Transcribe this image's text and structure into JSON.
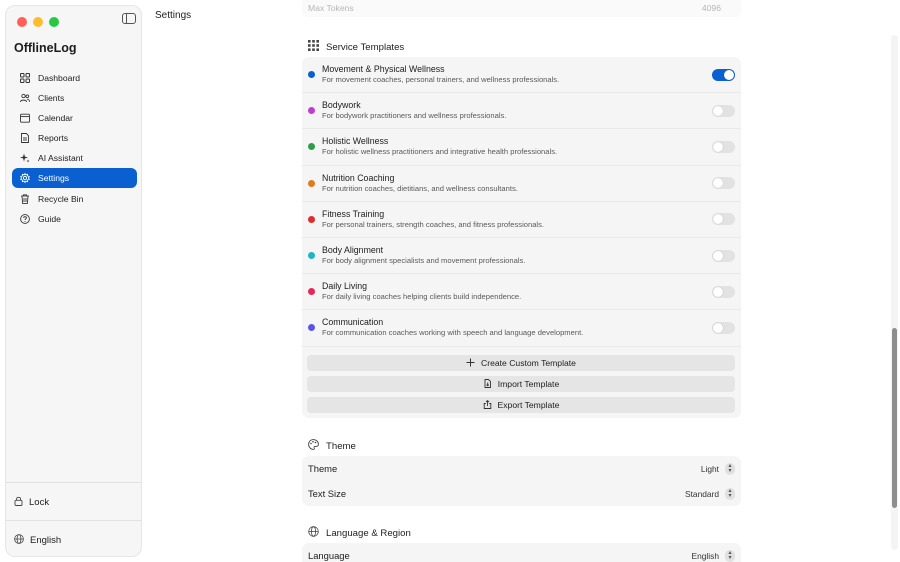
{
  "app": {
    "title": "OfflineLog"
  },
  "header": {
    "title": "Settings"
  },
  "sidebar": {
    "items": [
      {
        "label": "Dashboard",
        "icon": "grid-icon"
      },
      {
        "label": "Clients",
        "icon": "people-icon"
      },
      {
        "label": "Calendar",
        "icon": "calendar-icon"
      },
      {
        "label": "Reports",
        "icon": "document-icon"
      },
      {
        "label": "AI Assistant",
        "icon": "sparkle-icon"
      },
      {
        "label": "Settings",
        "icon": "gear-icon",
        "active": true
      },
      {
        "label": "Recycle Bin",
        "icon": "trash-icon"
      },
      {
        "label": "Guide",
        "icon": "question-icon"
      }
    ],
    "lock_label": "Lock",
    "language_label": "English"
  },
  "top_faded": {
    "label": "Max Tokens",
    "value": "4096"
  },
  "service_templates": {
    "title": "Service Templates",
    "items": [
      {
        "name": "Movement & Physical Wellness",
        "desc": "For movement coaches, personal trainers, and wellness professionals.",
        "color": "#0a60d0",
        "enabled": true
      },
      {
        "name": "Bodywork",
        "desc": "For bodywork practitioners and wellness professionals.",
        "color": "#c33bd6",
        "enabled": false
      },
      {
        "name": "Holistic Wellness",
        "desc": "For holistic wellness practitioners and integrative health professionals.",
        "color": "#2e9d4a",
        "enabled": false
      },
      {
        "name": "Nutrition Coaching",
        "desc": "For nutrition coaches, dietitians, and wellness consultants.",
        "color": "#e07a1a",
        "enabled": false
      },
      {
        "name": "Fitness Training",
        "desc": "For personal trainers, strength coaches, and fitness professionals.",
        "color": "#df2d2d",
        "enabled": false
      },
      {
        "name": "Body Alignment",
        "desc": "For body alignment specialists and movement professionals.",
        "color": "#1fb5c7",
        "enabled": false
      },
      {
        "name": "Daily Living",
        "desc": "For daily living coaches helping clients build independence.",
        "color": "#e8245a",
        "enabled": false
      },
      {
        "name": "Communication",
        "desc": "For communication coaches working with speech and language development.",
        "color": "#5a55e6",
        "enabled": false
      }
    ],
    "buttons": {
      "create": "Create Custom Template",
      "import": "Import Template",
      "export": "Export Template"
    }
  },
  "theme": {
    "title": "Theme",
    "rows": [
      {
        "label": "Theme",
        "value": "Light"
      },
      {
        "label": "Text Size",
        "value": "Standard"
      }
    ]
  },
  "language_region": {
    "title": "Language & Region",
    "rows": [
      {
        "label": "Language",
        "value": "English"
      }
    ]
  }
}
